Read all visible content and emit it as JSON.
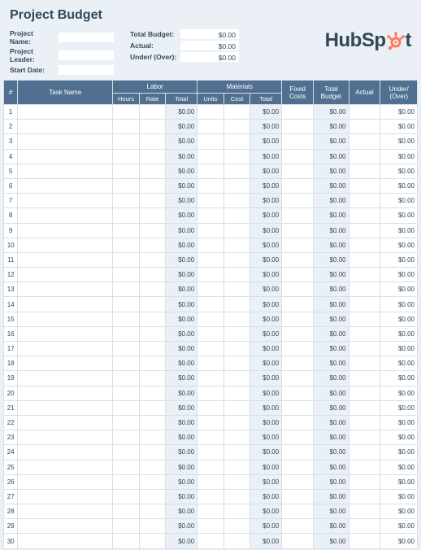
{
  "title": "Project Budget",
  "fields": {
    "project_name_label": "Project Name:",
    "project_name": "",
    "project_leader_label": "Project Leader:",
    "project_leader": "",
    "start_date_label": "Start Date:",
    "start_date": ""
  },
  "totals": {
    "total_budget_label": "Total Budget:",
    "total_budget": "$0.00",
    "actual_label": "Actual:",
    "actual": "$0.00",
    "under_over_label": "Under/ (Over):",
    "under_over": "$0.00"
  },
  "brand": {
    "name": "HubSpot",
    "part1": "HubSp",
    "part2": "t",
    "accent": "#FF7A59"
  },
  "columns": {
    "num": "#",
    "task": "Task Name",
    "labor": "Labor",
    "hours": "Hours",
    "rate": "Rate",
    "ltotal": "Total",
    "materials": "Materials",
    "units": "Units",
    "cost": "Cost",
    "mtotal": "Total",
    "fixed": "Fixed Costs",
    "tbudget": "Total Budget",
    "actual": "Actual",
    "uo": "Under/ (Over)"
  },
  "r": [
    {
      "n": "1",
      "t": "",
      "h": "",
      "r": "",
      "lt": "$0.00",
      "u": "",
      "c": "",
      "mt": "$0.00",
      "fc": "",
      "tb": "$0.00",
      "ac": "",
      "uo": "$0.00"
    },
    {
      "n": "2",
      "t": "",
      "h": "",
      "r": "",
      "lt": "$0.00",
      "u": "",
      "c": "",
      "mt": "$0.00",
      "fc": "",
      "tb": "$0.00",
      "ac": "",
      "uo": "$0.00"
    },
    {
      "n": "3",
      "t": "",
      "h": "",
      "r": "",
      "lt": "$0.00",
      "u": "",
      "c": "",
      "mt": "$0.00",
      "fc": "",
      "tb": "$0.00",
      "ac": "",
      "uo": "$0.00"
    },
    {
      "n": "4",
      "t": "",
      "h": "",
      "r": "",
      "lt": "$0.00",
      "u": "",
      "c": "",
      "mt": "$0.00",
      "fc": "",
      "tb": "$0.00",
      "ac": "",
      "uo": "$0.00"
    },
    {
      "n": "5",
      "t": "",
      "h": "",
      "r": "",
      "lt": "$0.00",
      "u": "",
      "c": "",
      "mt": "$0.00",
      "fc": "",
      "tb": "$0.00",
      "ac": "",
      "uo": "$0.00"
    },
    {
      "n": "6",
      "t": "",
      "h": "",
      "r": "",
      "lt": "$0.00",
      "u": "",
      "c": "",
      "mt": "$0.00",
      "fc": "",
      "tb": "$0.00",
      "ac": "",
      "uo": "$0.00"
    },
    {
      "n": "7",
      "t": "",
      "h": "",
      "r": "",
      "lt": "$0.00",
      "u": "",
      "c": "",
      "mt": "$0.00",
      "fc": "",
      "tb": "$0.00",
      "ac": "",
      "uo": "$0.00"
    },
    {
      "n": "8",
      "t": "",
      "h": "",
      "r": "",
      "lt": "$0.00",
      "u": "",
      "c": "",
      "mt": "$0.00",
      "fc": "",
      "tb": "$0.00",
      "ac": "",
      "uo": "$0.00"
    },
    {
      "n": "9",
      "t": "",
      "h": "",
      "r": "",
      "lt": "$0.00",
      "u": "",
      "c": "",
      "mt": "$0.00",
      "fc": "",
      "tb": "$0.00",
      "ac": "",
      "uo": "$0.00"
    },
    {
      "n": "10",
      "t": "",
      "h": "",
      "r": "",
      "lt": "$0.00",
      "u": "",
      "c": "",
      "mt": "$0.00",
      "fc": "",
      "tb": "$0.00",
      "ac": "",
      "uo": "$0.00"
    },
    {
      "n": "11",
      "t": "",
      "h": "",
      "r": "",
      "lt": "$0.00",
      "u": "",
      "c": "",
      "mt": "$0.00",
      "fc": "",
      "tb": "$0.00",
      "ac": "",
      "uo": "$0.00"
    },
    {
      "n": "12",
      "t": "",
      "h": "",
      "r": "",
      "lt": "$0.00",
      "u": "",
      "c": "",
      "mt": "$0.00",
      "fc": "",
      "tb": "$0.00",
      "ac": "",
      "uo": "$0.00"
    },
    {
      "n": "13",
      "t": "",
      "h": "",
      "r": "",
      "lt": "$0.00",
      "u": "",
      "c": "",
      "mt": "$0.00",
      "fc": "",
      "tb": "$0.00",
      "ac": "",
      "uo": "$0.00"
    },
    {
      "n": "14",
      "t": "",
      "h": "",
      "r": "",
      "lt": "$0.00",
      "u": "",
      "c": "",
      "mt": "$0.00",
      "fc": "",
      "tb": "$0.00",
      "ac": "",
      "uo": "$0.00"
    },
    {
      "n": "15",
      "t": "",
      "h": "",
      "r": "",
      "lt": "$0.00",
      "u": "",
      "c": "",
      "mt": "$0.00",
      "fc": "",
      "tb": "$0.00",
      "ac": "",
      "uo": "$0.00"
    },
    {
      "n": "16",
      "t": "",
      "h": "",
      "r": "",
      "lt": "$0.00",
      "u": "",
      "c": "",
      "mt": "$0.00",
      "fc": "",
      "tb": "$0.00",
      "ac": "",
      "uo": "$0.00"
    },
    {
      "n": "17",
      "t": "",
      "h": "",
      "r": "",
      "lt": "$0.00",
      "u": "",
      "c": "",
      "mt": "$0.00",
      "fc": "",
      "tb": "$0.00",
      "ac": "",
      "uo": "$0.00"
    },
    {
      "n": "18",
      "t": "",
      "h": "",
      "r": "",
      "lt": "$0.00",
      "u": "",
      "c": "",
      "mt": "$0.00",
      "fc": "",
      "tb": "$0.00",
      "ac": "",
      "uo": "$0.00"
    },
    {
      "n": "19",
      "t": "",
      "h": "",
      "r": "",
      "lt": "$0.00",
      "u": "",
      "c": "",
      "mt": "$0.00",
      "fc": "",
      "tb": "$0.00",
      "ac": "",
      "uo": "$0.00"
    },
    {
      "n": "20",
      "t": "",
      "h": "",
      "r": "",
      "lt": "$0.00",
      "u": "",
      "c": "",
      "mt": "$0.00",
      "fc": "",
      "tb": "$0.00",
      "ac": "",
      "uo": "$0.00"
    },
    {
      "n": "21",
      "t": "",
      "h": "",
      "r": "",
      "lt": "$0.00",
      "u": "",
      "c": "",
      "mt": "$0.00",
      "fc": "",
      "tb": "$0.00",
      "ac": "",
      "uo": "$0.00"
    },
    {
      "n": "22",
      "t": "",
      "h": "",
      "r": "",
      "lt": "$0.00",
      "u": "",
      "c": "",
      "mt": "$0.00",
      "fc": "",
      "tb": "$0.00",
      "ac": "",
      "uo": "$0.00"
    },
    {
      "n": "23",
      "t": "",
      "h": "",
      "r": "",
      "lt": "$0.00",
      "u": "",
      "c": "",
      "mt": "$0.00",
      "fc": "",
      "tb": "$0.00",
      "ac": "",
      "uo": "$0.00"
    },
    {
      "n": "24",
      "t": "",
      "h": "",
      "r": "",
      "lt": "$0.00",
      "u": "",
      "c": "",
      "mt": "$0.00",
      "fc": "",
      "tb": "$0.00",
      "ac": "",
      "uo": "$0.00"
    },
    {
      "n": "25",
      "t": "",
      "h": "",
      "r": "",
      "lt": "$0.00",
      "u": "",
      "c": "",
      "mt": "$0.00",
      "fc": "",
      "tb": "$0.00",
      "ac": "",
      "uo": "$0.00"
    },
    {
      "n": "26",
      "t": "",
      "h": "",
      "r": "",
      "lt": "$0.00",
      "u": "",
      "c": "",
      "mt": "$0.00",
      "fc": "",
      "tb": "$0.00",
      "ac": "",
      "uo": "$0.00"
    },
    {
      "n": "27",
      "t": "",
      "h": "",
      "r": "",
      "lt": "$0.00",
      "u": "",
      "c": "",
      "mt": "$0.00",
      "fc": "",
      "tb": "$0.00",
      "ac": "",
      "uo": "$0.00"
    },
    {
      "n": "28",
      "t": "",
      "h": "",
      "r": "",
      "lt": "$0.00",
      "u": "",
      "c": "",
      "mt": "$0.00",
      "fc": "",
      "tb": "$0.00",
      "ac": "",
      "uo": "$0.00"
    },
    {
      "n": "29",
      "t": "",
      "h": "",
      "r": "",
      "lt": "$0.00",
      "u": "",
      "c": "",
      "mt": "$0.00",
      "fc": "",
      "tb": "$0.00",
      "ac": "",
      "uo": "$0.00"
    },
    {
      "n": "30",
      "t": "",
      "h": "",
      "r": "",
      "lt": "$0.00",
      "u": "",
      "c": "",
      "mt": "$0.00",
      "fc": "",
      "tb": "$0.00",
      "ac": "",
      "uo": "$0.00"
    }
  ]
}
